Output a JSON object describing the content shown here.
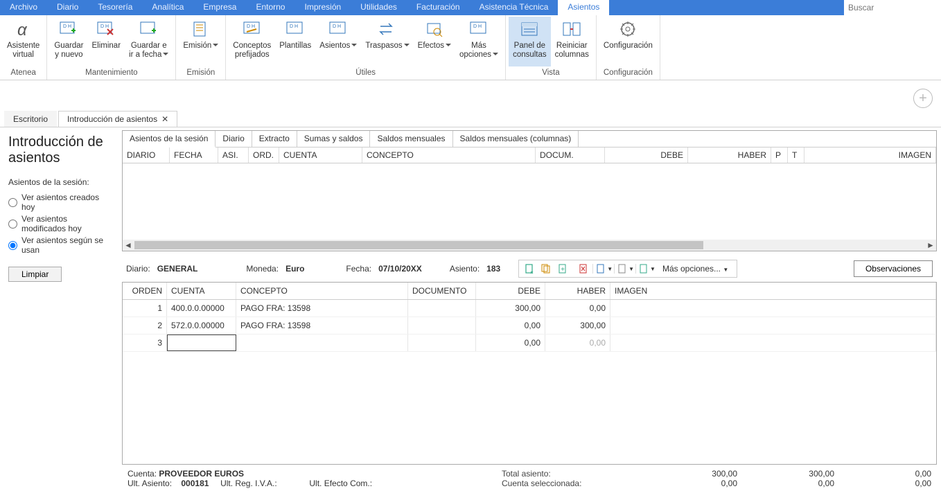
{
  "search_placeholder": "Buscar",
  "menu": [
    "Archivo",
    "Diario",
    "Tesorería",
    "Analítica",
    "Empresa",
    "Entorno",
    "Impresión",
    "Utilidades",
    "Facturación",
    "Asistencia Técnica",
    "Asientos"
  ],
  "menu_active_index": 10,
  "ribbon": {
    "groups": [
      {
        "label": "Atenea",
        "buttons": [
          {
            "label": "Asistente\nvirtual"
          }
        ]
      },
      {
        "label": "Mantenimiento",
        "buttons": [
          {
            "label": "Guardar\ny nuevo"
          },
          {
            "label": "Eliminar"
          },
          {
            "label": "Guardar e\nir a fecha",
            "drop": true
          }
        ]
      },
      {
        "label": "Emisión",
        "buttons": [
          {
            "label": "Emisión",
            "drop": true
          }
        ]
      },
      {
        "label": "Útiles",
        "buttons": [
          {
            "label": "Conceptos\nprefijados"
          },
          {
            "label": "Plantillas"
          },
          {
            "label": "Asientos",
            "drop": true
          },
          {
            "label": "Traspasos",
            "drop": true
          },
          {
            "label": "Efectos",
            "drop": true
          },
          {
            "label": "Más\nopciones",
            "drop": true
          }
        ]
      },
      {
        "label": "Vista",
        "buttons": [
          {
            "label": "Panel de\nconsultas",
            "hl": true
          },
          {
            "label": "Reiniciar\ncolumnas"
          }
        ]
      },
      {
        "label": "Configuración",
        "buttons": [
          {
            "label": "Configuración"
          }
        ]
      }
    ]
  },
  "doctabs": [
    {
      "label": "Escritorio",
      "closable": false
    },
    {
      "label": "Introducción de asientos",
      "closable": true,
      "active": true
    }
  ],
  "page_title": "Introducción de asientos",
  "sidebar": {
    "heading": "Asientos de la sesión:",
    "options": [
      {
        "label": "Ver asientos creados hoy",
        "checked": false
      },
      {
        "label": "Ver asientos modificados hoy",
        "checked": false
      },
      {
        "label": "Ver asientos según se usan",
        "checked": true
      }
    ],
    "clear_label": "Limpiar"
  },
  "subtabs": [
    "Asientos de la sesión",
    "Diario",
    "Extracto",
    "Sumas y saldos",
    "Saldos mensuales",
    "Saldos mensuales (columnas)"
  ],
  "subtab_active": 0,
  "session_grid_headers": [
    "DIARIO",
    "FECHA",
    "ASI.",
    "ORD.",
    "CUENTA",
    "CONCEPTO",
    "DOCUM.",
    "DEBE",
    "HABER",
    "P",
    "T",
    "IMAGEN"
  ],
  "info": {
    "diario_label": "Diario:",
    "diario_value": "GENERAL",
    "moneda_label": "Moneda:",
    "moneda_value": "Euro",
    "fecha_label": "Fecha:",
    "fecha_value": "07/10/20XX",
    "asiento_label": "Asiento:",
    "asiento_value": "183",
    "more_label": "Más opciones...",
    "obs_label": "Observaciones"
  },
  "entry_headers": {
    "orden": "ORDEN",
    "cuenta": "CUENTA",
    "concepto": "CONCEPTO",
    "documento": "DOCUMENTO",
    "debe": "DEBE",
    "haber": "HABER",
    "imagen": "IMAGEN"
  },
  "entries": [
    {
      "orden": "1",
      "cuenta": "400.0.0.00000",
      "concepto": "PAGO FRA: 13598",
      "documento": "",
      "debe": "300,00",
      "haber": "0,00",
      "imagen": ""
    },
    {
      "orden": "2",
      "cuenta": "572.0.0.00000",
      "concepto": "PAGO FRA: 13598",
      "documento": "",
      "debe": "0,00",
      "haber": "300,00",
      "imagen": ""
    },
    {
      "orden": "3",
      "cuenta": "",
      "concepto": "",
      "documento": "",
      "debe": "0,00",
      "haber": "0,00",
      "imagen": "",
      "editing": true,
      "haber_faded": true
    }
  ],
  "footer": {
    "cuenta_label": "Cuenta:",
    "cuenta_value": "PROVEEDOR EUROS",
    "ult_asiento_label": "Ult. Asiento:",
    "ult_asiento_value": "000181",
    "ult_reg_iva_label": "Ult. Reg. I.V.A.:",
    "ult_reg_iva_value": "",
    "ult_efecto_label": "Ult. Efecto Com.:",
    "ult_efecto_value": "",
    "totals": [
      {
        "label": "Total asiento:",
        "c1": "300,00",
        "c2": "300,00",
        "c3": "0,00"
      },
      {
        "label": "Cuenta seleccionada:",
        "c1": "0,00",
        "c2": "0,00",
        "c3": "0,00"
      }
    ]
  }
}
